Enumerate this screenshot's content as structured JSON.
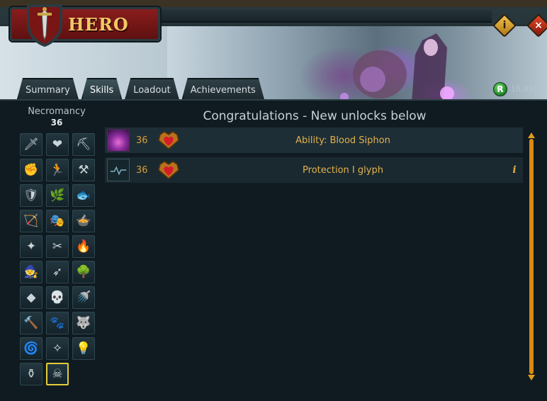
{
  "window": {
    "title": "HERO",
    "info_glyph": "i",
    "close_glyph": "×"
  },
  "tabs": [
    {
      "label": "Summary"
    },
    {
      "label": "Skills"
    },
    {
      "label": "Loadout"
    },
    {
      "label": "Achievements"
    }
  ],
  "active_tab": "Skills",
  "currency": {
    "icon": "R",
    "value": "16,450"
  },
  "skill_panel": {
    "name": "Necromancy",
    "level": "36",
    "selected_skill": "necromancy",
    "skills": [
      {
        "name": "attack",
        "glyph": "🗡"
      },
      {
        "name": "constitution",
        "glyph": "❤"
      },
      {
        "name": "mining",
        "glyph": "⛏"
      },
      {
        "name": "strength",
        "glyph": "✊"
      },
      {
        "name": "agility",
        "glyph": "🏃"
      },
      {
        "name": "smithing",
        "glyph": "⚒"
      },
      {
        "name": "defence",
        "glyph": "🛡"
      },
      {
        "name": "herblore",
        "glyph": "🌿"
      },
      {
        "name": "fishing",
        "glyph": "🐟"
      },
      {
        "name": "ranged",
        "glyph": "🏹"
      },
      {
        "name": "thieving",
        "glyph": "🎭"
      },
      {
        "name": "cooking",
        "glyph": "🍲"
      },
      {
        "name": "prayer",
        "glyph": "✦"
      },
      {
        "name": "crafting",
        "glyph": "✂"
      },
      {
        "name": "firemaking",
        "glyph": "🔥"
      },
      {
        "name": "magic",
        "glyph": "🧙"
      },
      {
        "name": "fletching",
        "glyph": "➶"
      },
      {
        "name": "woodcutting",
        "glyph": "🌳"
      },
      {
        "name": "runecrafting",
        "glyph": "◆"
      },
      {
        "name": "slayer",
        "glyph": "💀"
      },
      {
        "name": "farming",
        "glyph": "🚿"
      },
      {
        "name": "construction",
        "glyph": "🔨"
      },
      {
        "name": "hunter",
        "glyph": "🐾"
      },
      {
        "name": "summoning",
        "glyph": "🐺"
      },
      {
        "name": "dungeoneering",
        "glyph": "🌀"
      },
      {
        "name": "divination",
        "glyph": "✧"
      },
      {
        "name": "invention",
        "glyph": "💡"
      },
      {
        "name": "archaeology",
        "glyph": "⚱"
      },
      {
        "name": "necromancy",
        "glyph": "☠"
      }
    ]
  },
  "content": {
    "heading": "Congratulations - New unlocks below",
    "unlocks": [
      {
        "icon": "blood-siphon-icon",
        "level": "36",
        "label": "Ability: Blood Siphon",
        "has_info": false
      },
      {
        "icon": "glyph-icon",
        "level": "36",
        "label": "Protection I glyph",
        "has_info": true,
        "info": "i"
      }
    ]
  },
  "colors": {
    "accent_gold": "#e2b24a",
    "level_orange": "#d8a03a",
    "selected_border": "#e3cb3a",
    "title_red": "#8a1d1d"
  }
}
